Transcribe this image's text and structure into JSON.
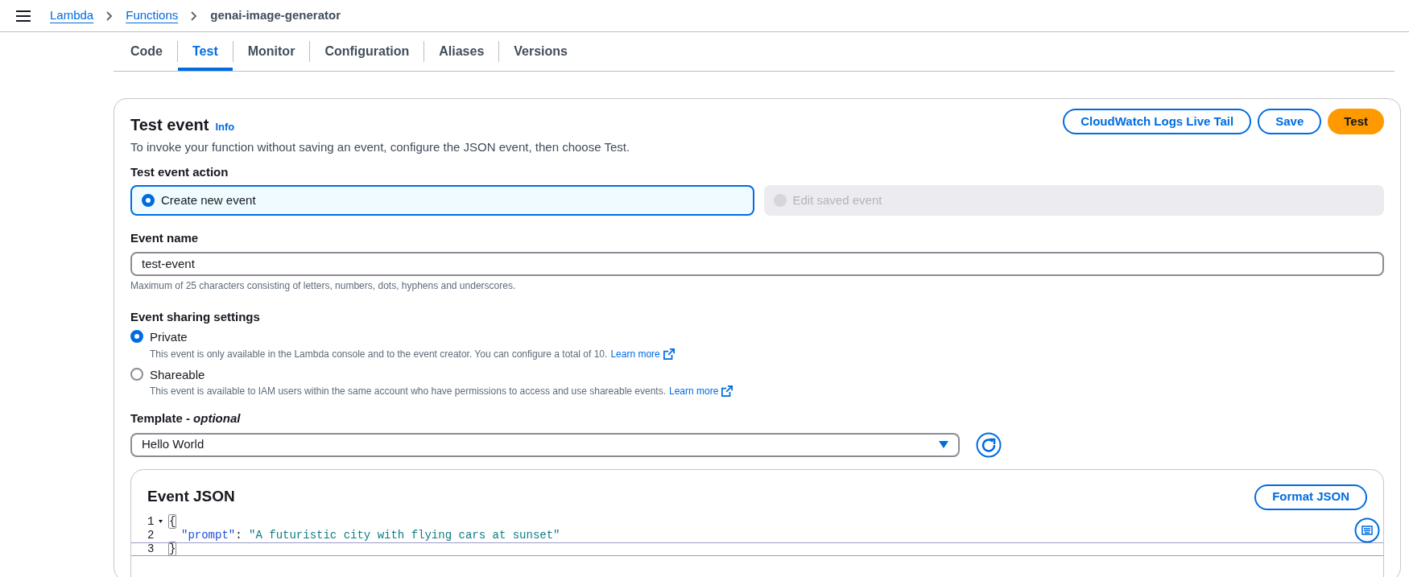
{
  "breadcrumbs": [
    {
      "label": "Lambda",
      "kind": "link"
    },
    {
      "label": "Functions",
      "kind": "link"
    },
    {
      "label": "genai-image-generator",
      "kind": "current"
    }
  ],
  "tabs": [
    {
      "label": "Code",
      "selected": false
    },
    {
      "label": "Test",
      "selected": true
    },
    {
      "label": "Monitor",
      "selected": false
    },
    {
      "label": "Configuration",
      "selected": false
    },
    {
      "label": "Aliases",
      "selected": false
    },
    {
      "label": "Versions",
      "selected": false
    }
  ],
  "test_event": {
    "title": "Test event",
    "info_link": "Info",
    "description": "To invoke your function without saving an event, configure the JSON event, then choose Test.",
    "buttons": [
      {
        "label": "CloudWatch Logs Live Tail",
        "kind": "outline"
      },
      {
        "label": "Save",
        "kind": "outline"
      },
      {
        "label": "Test",
        "kind": "primary"
      }
    ],
    "action": {
      "label": "Test event action",
      "options": [
        {
          "label": "Create new event",
          "selected": true,
          "disabled": false
        },
        {
          "label": "Edit saved event",
          "selected": false,
          "disabled": true
        }
      ]
    },
    "event_name": {
      "label": "Event name",
      "value": "test-event",
      "hint": "Maximum of 25 characters consisting of letters, numbers, dots, hyphens and underscores."
    },
    "sharing": {
      "label": "Event sharing settings",
      "options": [
        {
          "label": "Private",
          "description": "This event is only available in the Lambda console and to the event creator. You can configure a total of 10.",
          "link": "Learn more",
          "selected": true
        },
        {
          "label": "Shareable",
          "description": "This event is available to IAM users within the same account who have permissions to access and use shareable events.",
          "link": "Learn more",
          "selected": false
        }
      ]
    },
    "template": {
      "label": "Template - *optional*",
      "value": "Hello World"
    },
    "event_json": {
      "title": "Event JSON",
      "button": "Format JSON",
      "lines": [
        {
          "number": "1",
          "foldable": true,
          "indented": false,
          "active": false,
          "tokens": [
            {
              "kind": "bracket-match",
              "text": "{"
            }
          ]
        },
        {
          "number": "2",
          "foldable": false,
          "indented": true,
          "active": false,
          "tokens": [
            {
              "kind": "key",
              "text": "\"prompt\""
            },
            {
              "kind": "punct",
              "text": ": "
            },
            {
              "kind": "string",
              "text": "\"A futuristic city with flying cars at sunset\""
            }
          ]
        },
        {
          "number": "3",
          "foldable": false,
          "indented": false,
          "active": true,
          "tokens": [
            {
              "kind": "bracket-match",
              "text": "}"
            }
          ]
        }
      ]
    }
  }
}
